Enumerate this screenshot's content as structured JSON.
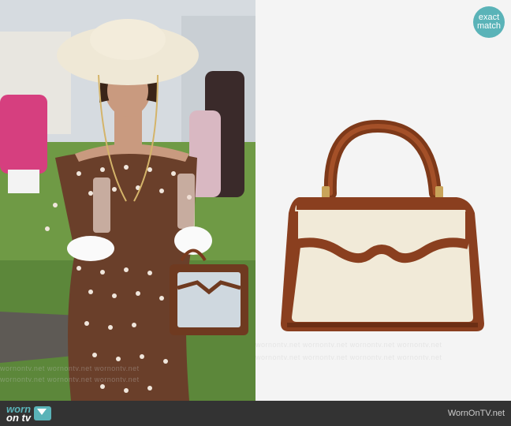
{
  "badge": {
    "line1": "exact",
    "line2": "match"
  },
  "footer": {
    "logo_worn": "worn",
    "logo_on": "on tv",
    "site": "WornOnTV.net"
  },
  "watermarks": {
    "left_rows": [
      "wornontv.net  wornontv.net  wornontv.net",
      "wornontv.net  wornontv.net  wornontv.net"
    ],
    "right_rows": [
      "wornontv.net  wornontv.net  wornontv.net  wornontv.net",
      "wornontv.net  wornontv.net  wornontv.net  wornontv.net"
    ]
  },
  "colors": {
    "brand": "#5ab3b8",
    "footer_bg": "#333333",
    "bag_leather": "#8a3f1f",
    "bag_canvas": "#f1ead8"
  }
}
